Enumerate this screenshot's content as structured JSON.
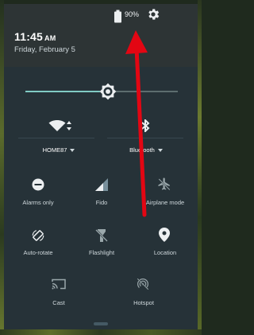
{
  "status": {
    "battery_text": "90%",
    "battery_icon": "battery-icon",
    "settings_icon": "gear-icon"
  },
  "header": {
    "time": "11:45",
    "ampm": "AM",
    "date": "Friday, February 5"
  },
  "brightness": {
    "level_percent": 54,
    "thumb_icon": "brightness-icon"
  },
  "tiles": {
    "wifi": {
      "label": "HOME87",
      "icon": "wifi-icon"
    },
    "bluetooth": {
      "label": "Bluetooth",
      "icon": "bluetooth-icon"
    },
    "alarms": {
      "label": "Alarms only",
      "icon": "do-not-disturb-icon"
    },
    "fido": {
      "label": "Fido",
      "icon": "signal-icon"
    },
    "airplane": {
      "label": "Airplane mode",
      "icon": "airplane-icon"
    },
    "autorotate": {
      "label": "Auto-rotate",
      "icon": "rotate-icon"
    },
    "flashlight": {
      "label": "Flashlight",
      "icon": "flashlight-icon"
    },
    "location": {
      "label": "Location",
      "icon": "location-pin-icon"
    },
    "cast": {
      "label": "Cast",
      "icon": "cast-icon"
    },
    "hotspot": {
      "label": "Hotspot",
      "icon": "hotspot-icon"
    }
  },
  "colors": {
    "panel": "#263238",
    "header": "#2d3435",
    "accent": "#80cbc4",
    "arrow": "#e30613"
  }
}
